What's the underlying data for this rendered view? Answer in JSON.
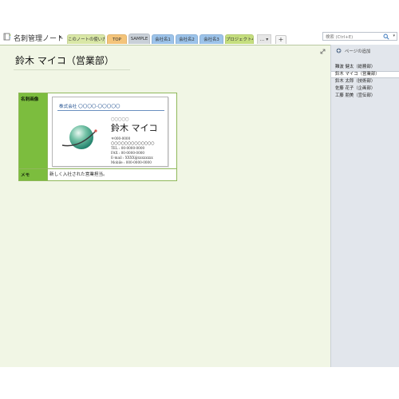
{
  "notebook": {
    "title": "名刺管理ノート",
    "caret": "▾"
  },
  "tabs": [
    {
      "label": "このノートの使い方",
      "color": "#d9e7a6"
    },
    {
      "label": "TOP",
      "color": "#f4c47a"
    },
    {
      "label": "SAMPLE",
      "color": "#c9d0d8",
      "active": true
    },
    {
      "label": "会社名1",
      "color": "#9cc3ea"
    },
    {
      "label": "会社名2",
      "color": "#9cc3ea"
    },
    {
      "label": "会社名3",
      "color": "#9cc3ea"
    },
    {
      "label": "プロジェクト4",
      "color": "#c5de7e"
    }
  ],
  "more_tab": {
    "label": "... ▾"
  },
  "add_tab": {
    "label": "+"
  },
  "search": {
    "placeholder": "検索 (Ctrl+E)",
    "caret": "▾"
  },
  "page": {
    "title": "鈴木 マイコ（営業部）",
    "table": {
      "image_label": "名刺画像",
      "memo_label": "メモ",
      "memo_value": "新しく入社された営業担当。"
    }
  },
  "card": {
    "company": "株式会社 〇〇〇〇-〇〇〇〇〇",
    "kana": "〇〇〇〇〇",
    "name": "鈴木 マイコ",
    "postal": "〒000-0000",
    "address": "〇〇〇〇〇〇〇〇〇〇〇〇〇",
    "tel": "TEL : 00-0000-0000",
    "fax": "FAX : 00-0000-0000",
    "email": "E-mail : XXXX@xxxxxxxx",
    "mobile": "Mobile : 000-0000-0000"
  },
  "sidebar": {
    "add_page": "ページの追加",
    "pages": [
      {
        "label": "難波 健太（総務部）"
      },
      {
        "label": "鈴木 マイコ（営業部）",
        "active": true
      },
      {
        "label": "鈴木 太郎（技術部）"
      },
      {
        "label": "佐藤 花子（企画部）"
      },
      {
        "label": "工藤 朋美（宣伝部）"
      }
    ]
  },
  "colors": {
    "page_background": "#f1f6e5",
    "label_cell": "#7cbd3e",
    "company_text": "#1f4f8f",
    "sidebar_background": "#e2e6ec"
  },
  "icons": {
    "notebook": "notebook-icon",
    "search": "magnifier-icon",
    "expand": "expand-arrows-icon",
    "add_page": "plus-circle-icon",
    "card_logo": "globe-logo"
  }
}
